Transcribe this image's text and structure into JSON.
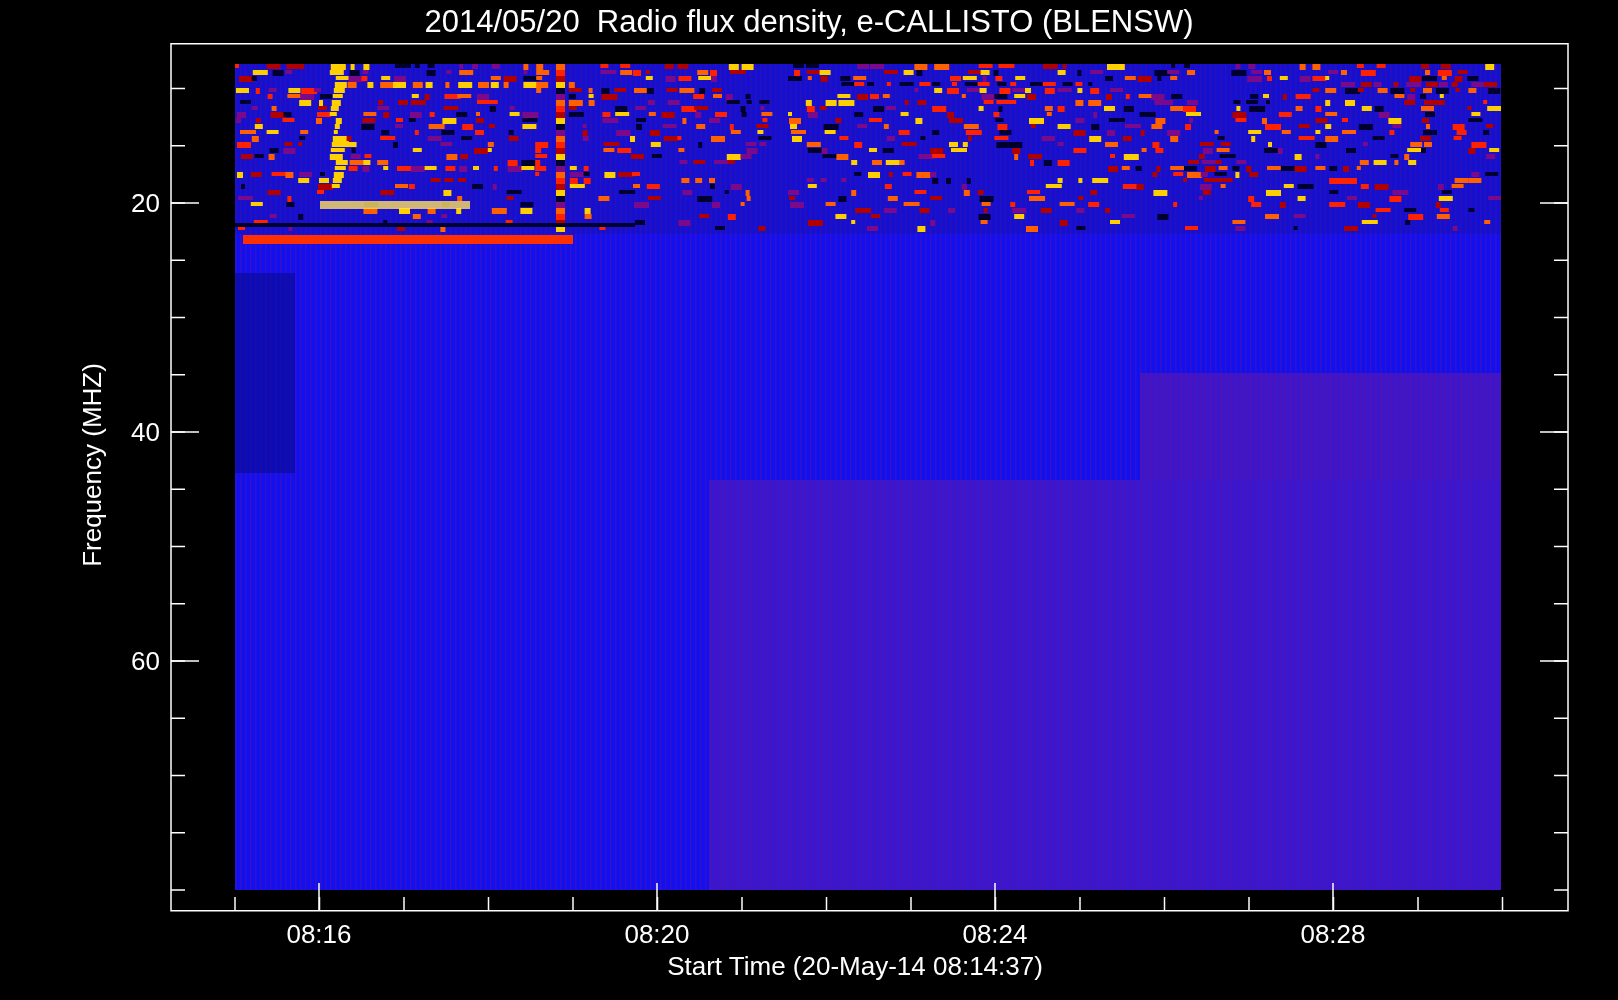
{
  "title": "2014/05/20  Radio flux density, e-CALLISTO (BLENSW)",
  "y_axis": {
    "title": "Frequency (MHZ)",
    "ticks": [
      "20",
      "40",
      "60"
    ]
  },
  "x_axis": {
    "title": "Start Time (20-May-14 08:14:37)",
    "ticks": [
      "08:16",
      "08:20",
      "08:24",
      "08:28"
    ]
  }
}
